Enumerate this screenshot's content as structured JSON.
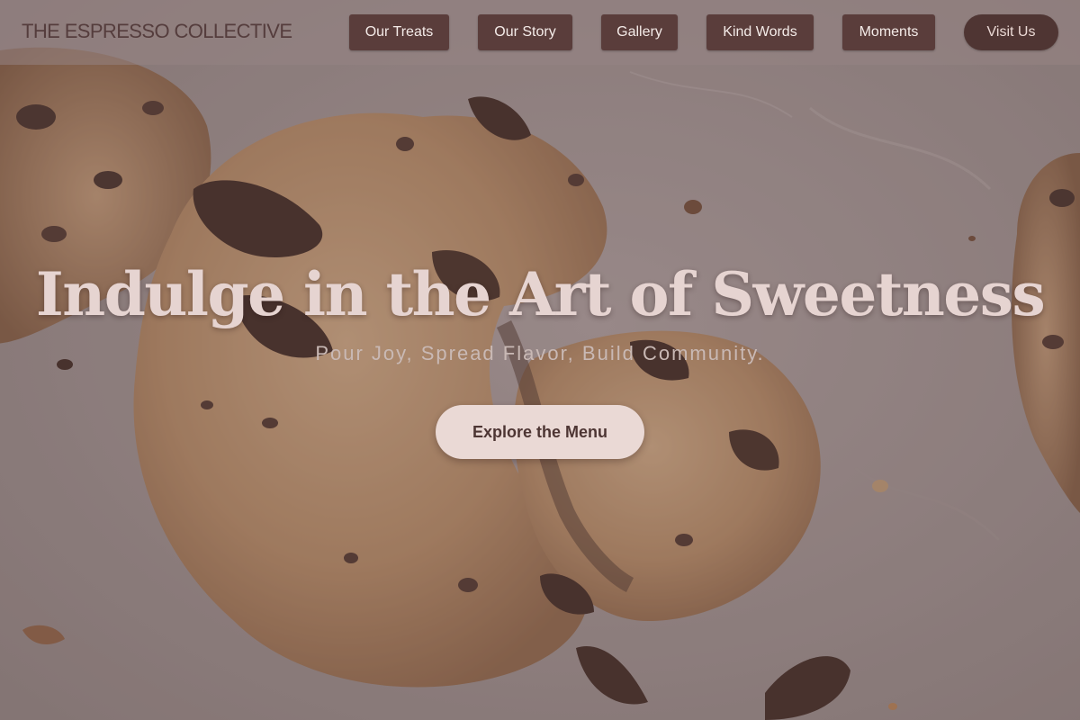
{
  "navbar": {
    "brand": "THE ESPRESSO COLLECTIVE",
    "links": [
      {
        "label": "Our Treats"
      },
      {
        "label": "Our Story"
      },
      {
        "label": "Gallery"
      },
      {
        "label": "Kind Words"
      },
      {
        "label": "Moments"
      }
    ],
    "visit_label": "Visit Us"
  },
  "hero": {
    "title": "Indulge in the Art of Sweetness",
    "subtitle": "Pour Joy, Spread Flavor, Build Community.",
    "cta_label": "Explore the Menu",
    "background": "chocolate-chip-cookies-photo"
  },
  "colors": {
    "nav_button": "#5a3d3b",
    "visit_button": "#4f3533",
    "cta_button": "#ead9d5",
    "hero_title": "#e6d4d1",
    "overlay": "#8d7d7a"
  }
}
